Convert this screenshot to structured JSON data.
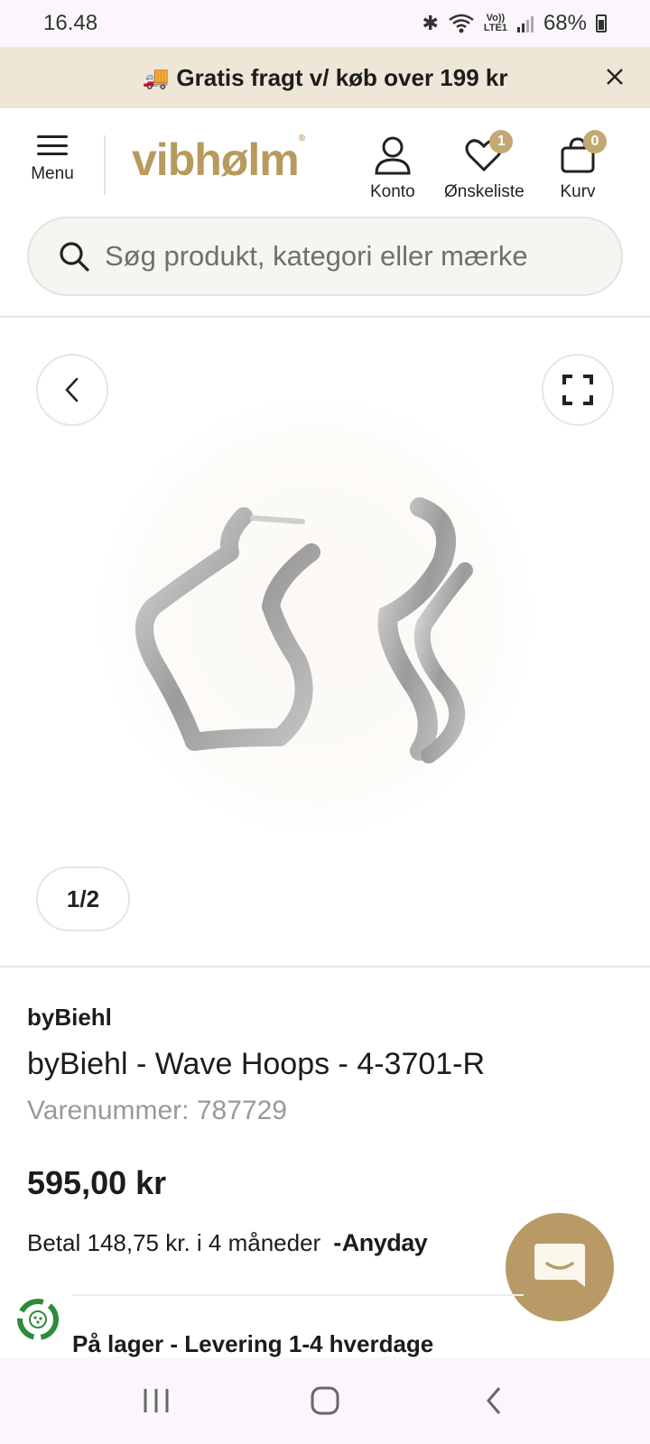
{
  "status": {
    "time": "16.48",
    "battery": "68%",
    "network_top": "Vo))",
    "network_bottom": "LTE1"
  },
  "promo": {
    "text": "Gratis fragt v/ køb over 199 kr"
  },
  "header": {
    "menu_label": "Menu",
    "logo_text": "vibhølm",
    "account_label": "Konto",
    "wishlist_label": "Ønskeliste",
    "wishlist_count": "1",
    "cart_label": "Kurv",
    "cart_count": "0"
  },
  "search": {
    "placeholder": "Søg produkt, kategori eller mærke"
  },
  "gallery": {
    "pager": "1/2"
  },
  "product": {
    "brand": "byBiehl",
    "title": "byBiehl - Wave Hoops - 4-3701-R",
    "sku_label": "Varenummer:",
    "sku_value": "787729",
    "price": "595,00 kr",
    "installment_text": "Betal 148,75 kr. i 4 måneder",
    "installment_provider": "Anyday",
    "stock_text": "På lager - Levering 1-4 hverdage"
  },
  "colors": {
    "accent": "#b89a5e",
    "promo_bg": "#eee6d6",
    "badge": "#c3a873"
  }
}
